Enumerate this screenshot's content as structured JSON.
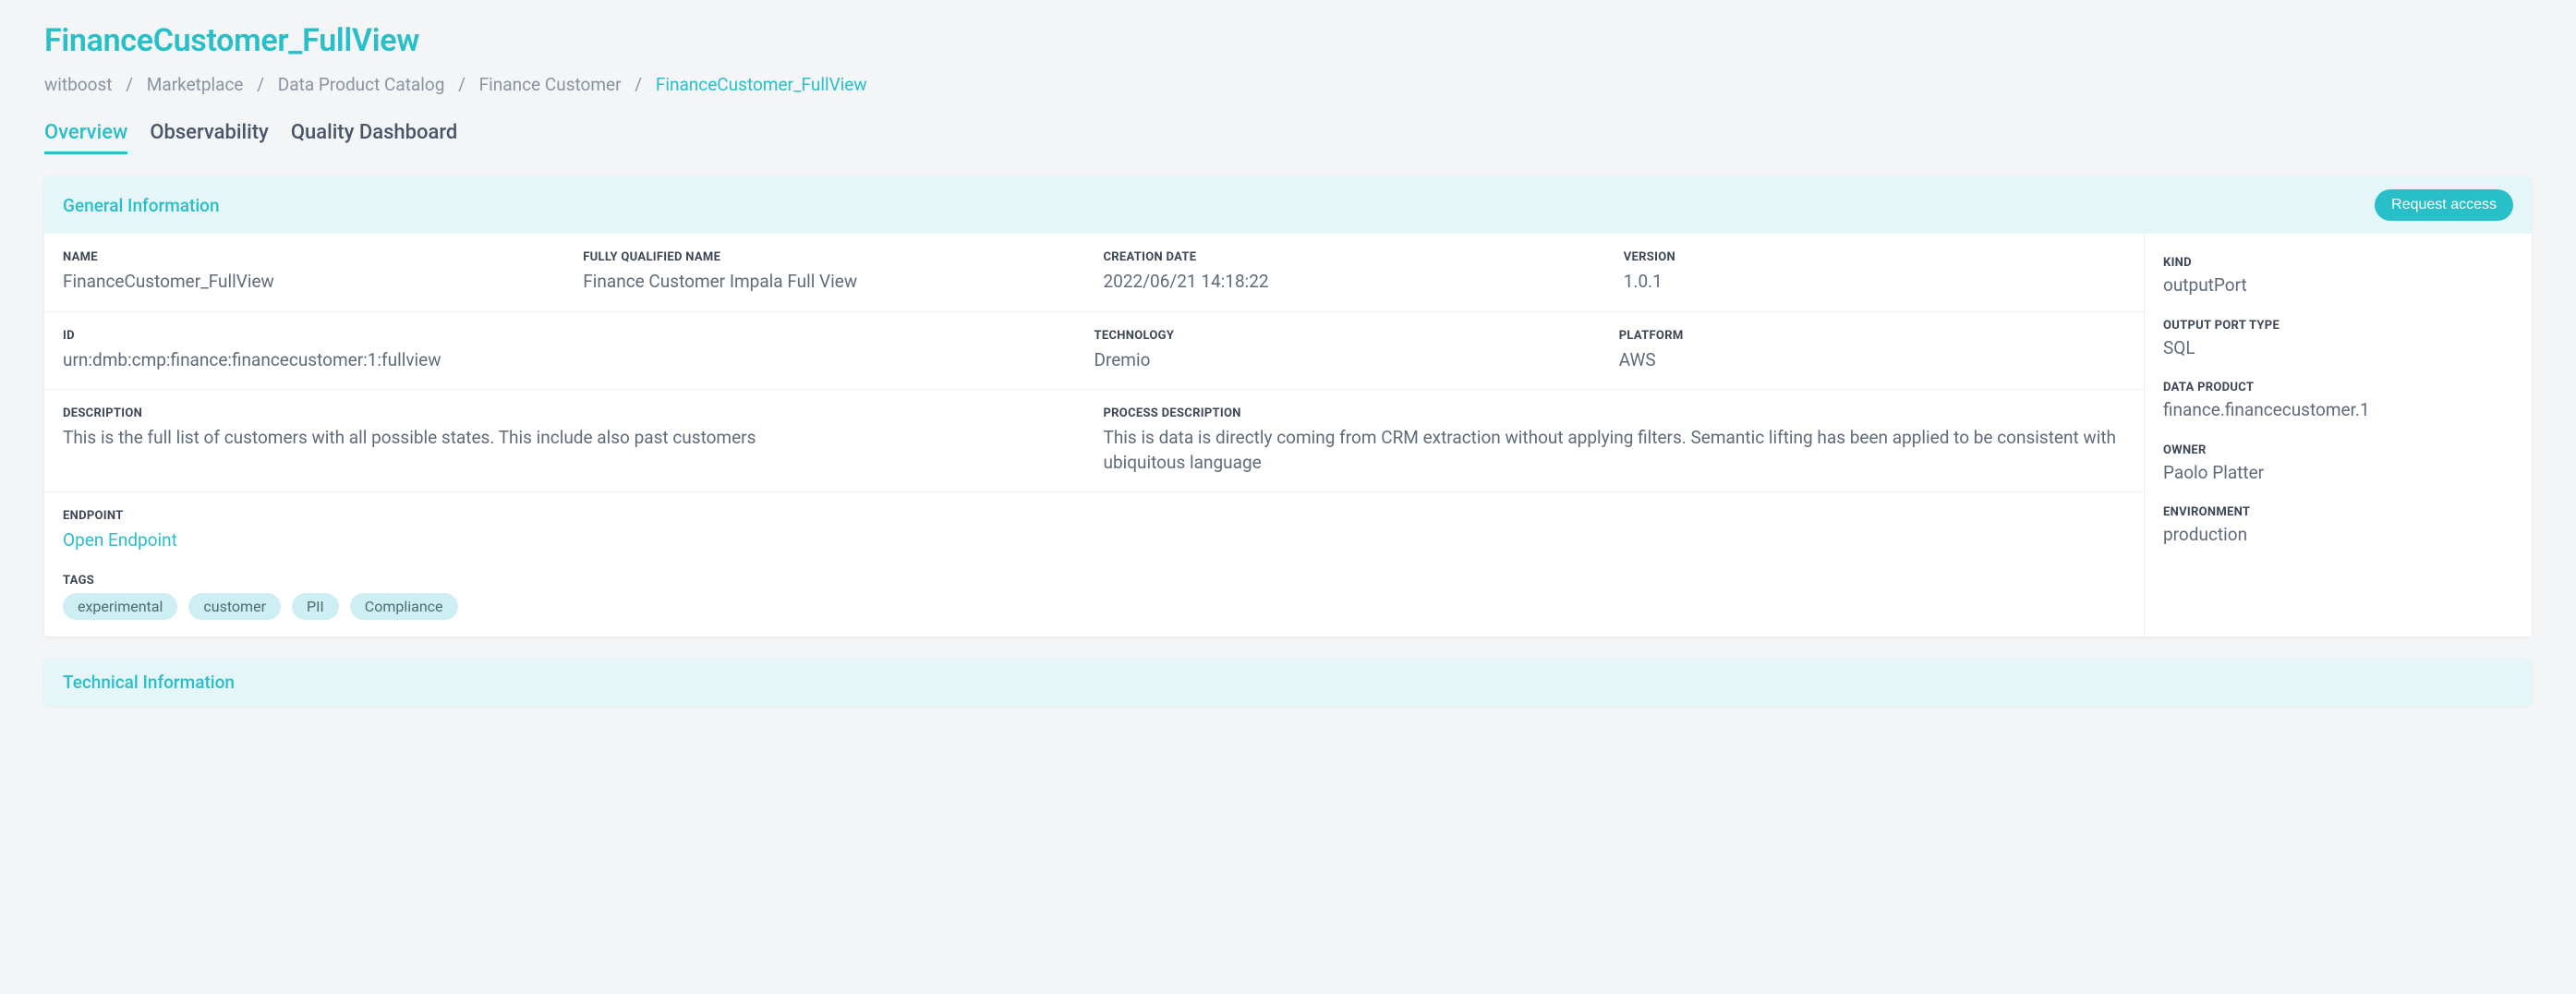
{
  "page": {
    "title": "FinanceCustomer_FullView"
  },
  "breadcrumb": {
    "items": [
      "witboost",
      "Marketplace",
      "Data Product Catalog",
      "Finance Customer"
    ],
    "current": "FinanceCustomer_FullView"
  },
  "tabs": {
    "overview": "Overview",
    "observability": "Observability",
    "quality": "Quality Dashboard"
  },
  "general": {
    "header": "General Information",
    "request_access": "Request access",
    "labels": {
      "name": "NAME",
      "fqn": "FULLY QUALIFIED NAME",
      "creation": "CREATION DATE",
      "version": "VERSION",
      "id": "ID",
      "technology": "TECHNOLOGY",
      "platform": "PLATFORM",
      "description": "DESCRIPTION",
      "process_description": "PROCESS DESCRIPTION",
      "endpoint": "ENDPOINT",
      "tags": "TAGS"
    },
    "values": {
      "name": "FinanceCustomer_FullView",
      "fqn": "Finance Customer Impala Full View",
      "creation": "2022/06/21 14:18:22",
      "version": "1.0.1",
      "id": "urn:dmb:cmp:finance:financecustomer:1:fullview",
      "technology": "Dremio",
      "platform": "AWS",
      "description": "This is the full list of customers with all possible states. This include also past customers",
      "process_description": "This is data is directly coming from CRM extraction without applying filters. Semantic lifting has been applied to be consistent with ubiquitous language",
      "endpoint_link": "Open Endpoint"
    },
    "tags": [
      "experimental",
      "customer",
      "PII",
      "Compliance"
    ],
    "side": {
      "kind_label": "KIND",
      "kind": "outputPort",
      "output_type_label": "OUTPUT PORT TYPE",
      "output_type": "SQL",
      "data_product_label": "DATA PRODUCT",
      "data_product": "finance.financecustomer.1",
      "owner_label": "OWNER",
      "owner": "Paolo Platter",
      "environment_label": "ENVIRONMENT",
      "environment": "production"
    }
  },
  "technical": {
    "header": "Technical Information"
  }
}
